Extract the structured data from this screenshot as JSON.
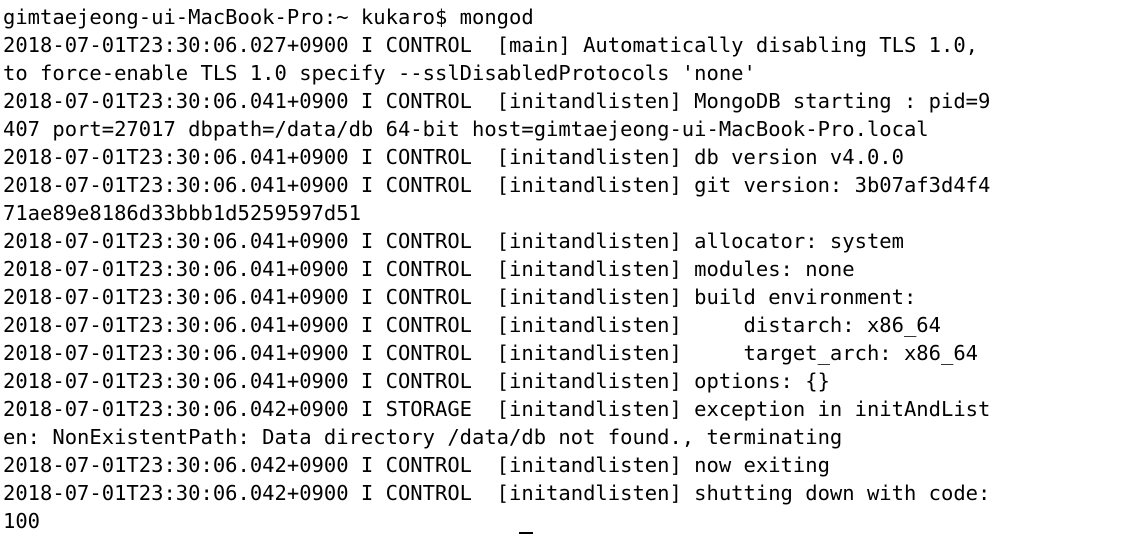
{
  "terminal": {
    "lines": [
      "gimtaejeong-ui-MacBook-Pro:~ kukaro$ mongod",
      "2018-07-01T23:30:06.027+0900 I CONTROL  [main] Automatically disabling TLS 1.0,",
      "to force-enable TLS 1.0 specify --sslDisabledProtocols 'none'",
      "2018-07-01T23:30:06.041+0900 I CONTROL  [initandlisten] MongoDB starting : pid=9",
      "407 port=27017 dbpath=/data/db 64-bit host=gimtaejeong-ui-MacBook-Pro.local",
      "2018-07-01T23:30:06.041+0900 I CONTROL  [initandlisten] db version v4.0.0",
      "2018-07-01T23:30:06.041+0900 I CONTROL  [initandlisten] git version: 3b07af3d4f4",
      "71ae89e8186d33bbb1d5259597d51",
      "2018-07-01T23:30:06.041+0900 I CONTROL  [initandlisten] allocator: system",
      "2018-07-01T23:30:06.041+0900 I CONTROL  [initandlisten] modules: none",
      "2018-07-01T23:30:06.041+0900 I CONTROL  [initandlisten] build environment:",
      "2018-07-01T23:30:06.041+0900 I CONTROL  [initandlisten]     distarch: x86_64",
      "2018-07-01T23:30:06.041+0900 I CONTROL  [initandlisten]     target_arch: x86_64",
      "2018-07-01T23:30:06.041+0900 I CONTROL  [initandlisten] options: {}",
      "2018-07-01T23:30:06.042+0900 I STORAGE  [initandlisten] exception in initAndList",
      "en: NonExistentPath: Data directory /data/db not found., terminating",
      "2018-07-01T23:30:06.042+0900 I CONTROL  [initandlisten] now exiting",
      "2018-07-01T23:30:06.042+0900 I CONTROL  [initandlisten] shutting down with code:",
      "100"
    ]
  }
}
